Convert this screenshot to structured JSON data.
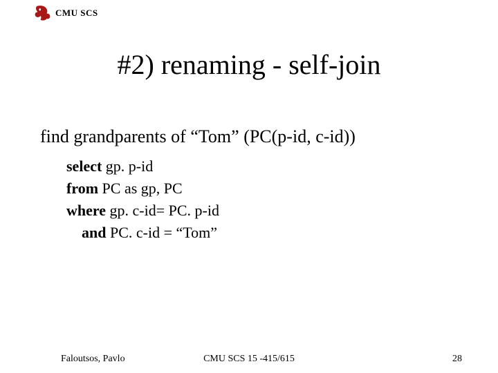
{
  "header": {
    "label": "CMU SCS"
  },
  "title": "#2) renaming - self-join",
  "description": "find grandparents of “Tom” (PC(p-id, c-id))",
  "sql": {
    "k_select": "select",
    "select_rest": " gp. p-id",
    "k_from": "from",
    "from_rest": " PC as gp, PC",
    "k_where": "where",
    "where_rest": " gp. c-id= PC. p-id",
    "k_and": "and",
    "and_rest": "  PC. c-id = “Tom”"
  },
  "footer": {
    "left": "Faloutsos, Pavlo",
    "center": "CMU SCS 15 -415/615",
    "right": "28"
  }
}
